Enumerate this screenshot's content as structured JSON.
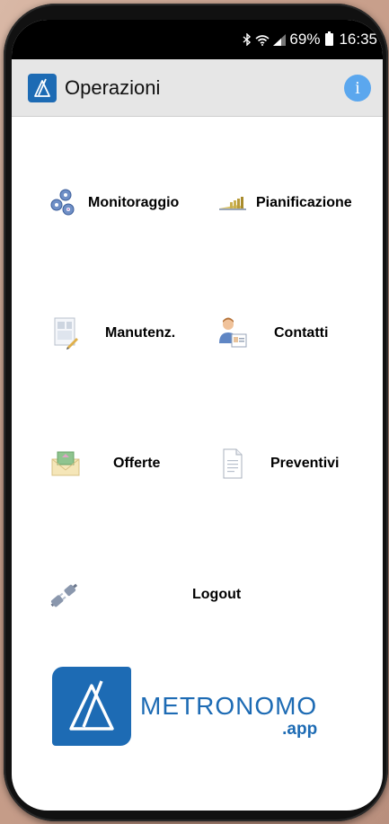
{
  "status_bar": {
    "battery": "69%",
    "time": "16:35",
    "icons": [
      "bluetooth-icon",
      "wifi-icon",
      "signal-icon",
      "battery-icon"
    ]
  },
  "header": {
    "title": "Operazioni",
    "info_label": "i"
  },
  "menu": {
    "monitoraggio": "Monitoraggio",
    "pianificazione": "Pianificazione",
    "manutenzione": "Manutenz.",
    "contatti": "Contatti",
    "offerte": "Offerte",
    "preventivi": "Preventivi",
    "logout": "Logout"
  },
  "brand": {
    "name": "METRONOMO",
    "domain": ".app"
  },
  "colors": {
    "brand_blue": "#1d6bb4",
    "info_blue": "#5ba7ee",
    "app_bar_bg": "#e6e6e6"
  }
}
